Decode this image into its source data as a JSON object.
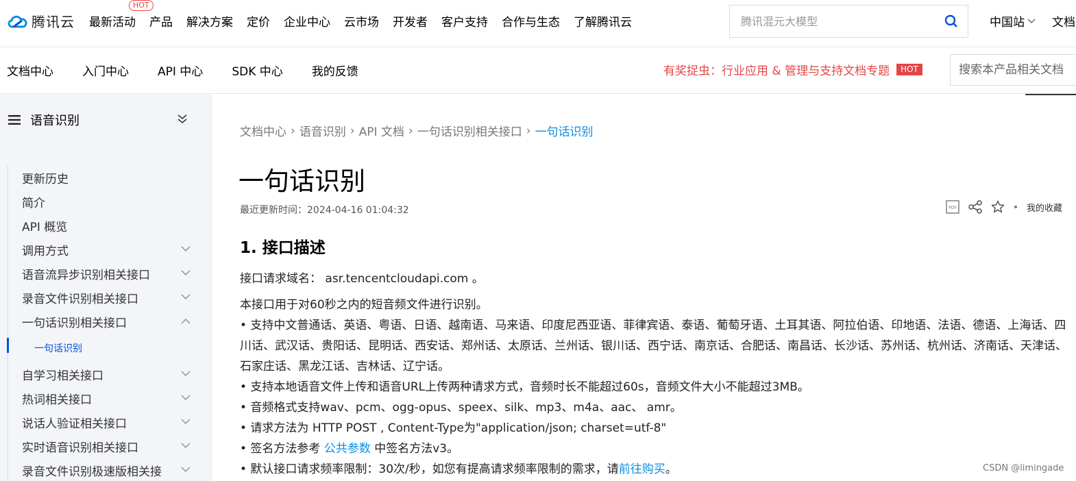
{
  "topnav": {
    "logo_text": "腾讯云",
    "hot_tag": "HOT",
    "items": [
      {
        "label": "最新活动"
      },
      {
        "label": "产品"
      },
      {
        "label": "解决方案"
      },
      {
        "label": "定价"
      },
      {
        "label": "企业中心"
      },
      {
        "label": "云市场"
      },
      {
        "label": "开发者"
      },
      {
        "label": "客户支持"
      },
      {
        "label": "合作与生态"
      },
      {
        "label": "了解腾讯云"
      }
    ],
    "search_placeholder": "腾讯混元大模型",
    "region": "中国站",
    "doc_link": "文档"
  },
  "subnav": {
    "items": [
      {
        "label": "文档中心"
      },
      {
        "label": "入门中心"
      },
      {
        "label": "API 中心"
      },
      {
        "label": "SDK 中心"
      },
      {
        "label": "我的反馈"
      }
    ],
    "promo": "有奖捉虫：行业应用 & 管理与支持文档专题",
    "promo_hot": "HOT",
    "search_placeholder": "搜索本产品相关文档"
  },
  "sidebar": {
    "title": "语音识别",
    "items": [
      {
        "label": "更新历史"
      },
      {
        "label": "简介"
      },
      {
        "label": "API 概览"
      },
      {
        "label": "调用方式"
      },
      {
        "label": "语音流异步识别相关接口"
      },
      {
        "label": "录音文件识别相关接口"
      },
      {
        "label": "一句话识别相关接口"
      },
      {
        "label": "一句话识别"
      },
      {
        "label": "自学习相关接口"
      },
      {
        "label": "热词相关接口"
      },
      {
        "label": "说话人验证相关接口"
      },
      {
        "label": "实时语音识别相关接口"
      },
      {
        "label": "录音文件识别极速版相关接"
      }
    ]
  },
  "breadcrumb": [
    "文档中心",
    "语音识别",
    "API 文档",
    "一句话识别相关接口",
    "一句话识别"
  ],
  "page": {
    "title": "一句话识别",
    "update_time": "最近更新时间：2024-04-16 01:04:32",
    "favorite": "我的收藏",
    "section_title": "1. 接口描述",
    "domain_label": "接口请求域名：",
    "domain_value": "asr.tencentcloudapi.com 。",
    "intro": "本接口用于对60秒之内的短音频文件进行识别。",
    "bullet1": "• 支持中文普通话、英语、粤语、日语、越南语、马来语、印度尼西亚语、菲律宾语、泰语、葡萄牙语、土耳其语、阿拉伯语、印地语、法语、德语、上海话、四川话、武汉话、贵阳话、昆明话、西安话、郑州话、太原话、兰州话、银川话、西宁话、南京话、合肥话、南昌话、长沙话、苏州话、杭州话、济南话、天津话、石家庄话、黑龙江话、吉林话、辽宁话。",
    "bullet2": "• 支持本地语音文件上传和语音URL上传两种请求方式，音频时长不能超过60s，音频文件大小不能超过3MB。",
    "bullet3": "• 音频格式支持wav、pcm、ogg-opus、speex、silk、mp3、m4a、aac、 amr。",
    "bullet4": "• 请求方法为 HTTP POST , Content-Type为\"application/json; charset=utf-8\"",
    "bullet5_prefix": "• 签名方法参考 ",
    "bullet5_link": "公共参数",
    "bullet5_suffix": " 中签名方法v3。",
    "bullet6_prefix": "• 默认接口请求频率限制：30次/秒，如您有提高请求频率限制的需求，请",
    "bullet6_link": "前往购买",
    "bullet6_suffix": "。"
  },
  "watermark": "CSDN @limingade",
  "colors": {
    "accent": "#0052d9",
    "link": "#0b8fe0",
    "hot": "#e54545",
    "sidebar_bg": "#f3f5f8"
  }
}
